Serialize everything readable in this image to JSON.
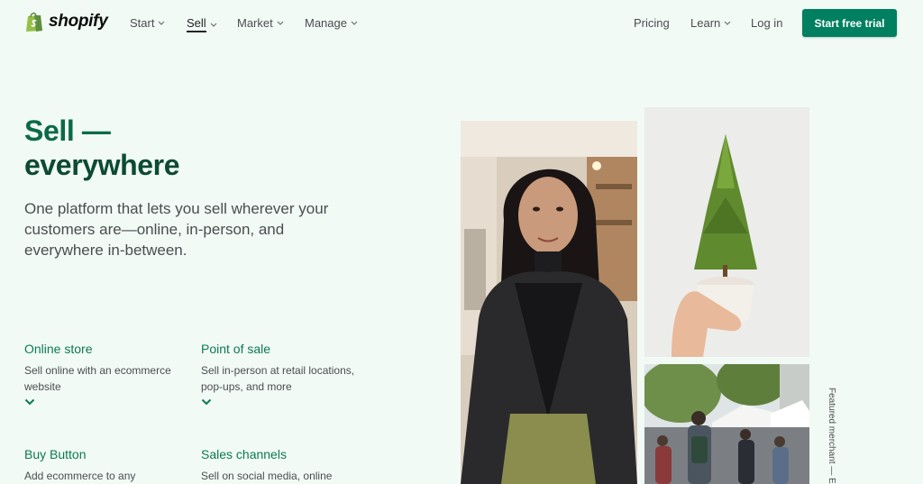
{
  "header": {
    "logo_text": "shopify",
    "nav": [
      {
        "label": "Start",
        "has_dropdown": true,
        "active": false
      },
      {
        "label": "Sell",
        "has_dropdown": true,
        "active": true
      },
      {
        "label": "Market",
        "has_dropdown": true,
        "active": false
      },
      {
        "label": "Manage",
        "has_dropdown": true,
        "active": false
      }
    ],
    "right_nav": [
      {
        "label": "Pricing",
        "has_dropdown": false
      },
      {
        "label": "Learn",
        "has_dropdown": true
      },
      {
        "label": "Log in",
        "has_dropdown": false
      }
    ],
    "cta_label": "Start free trial"
  },
  "hero": {
    "title_line1": "Sell —",
    "title_line2": "everywhere",
    "subtitle": "One platform that lets you sell wherever your customers are—online, in-person, and everywhere in-between."
  },
  "features": [
    {
      "title": "Online store",
      "desc": "Sell online with an ecommerce website"
    },
    {
      "title": "Point of sale",
      "desc": "Sell in-person at retail locations, pop-ups, and more"
    },
    {
      "title": "Buy Button",
      "desc": "Add ecommerce to any"
    },
    {
      "title": "Sales channels",
      "desc": "Sell on social media, online"
    }
  ],
  "side_caption": "Featured merchant — E",
  "colors": {
    "brand": "#008060",
    "heading": "#0b6a49",
    "background": "#f2faf5"
  }
}
